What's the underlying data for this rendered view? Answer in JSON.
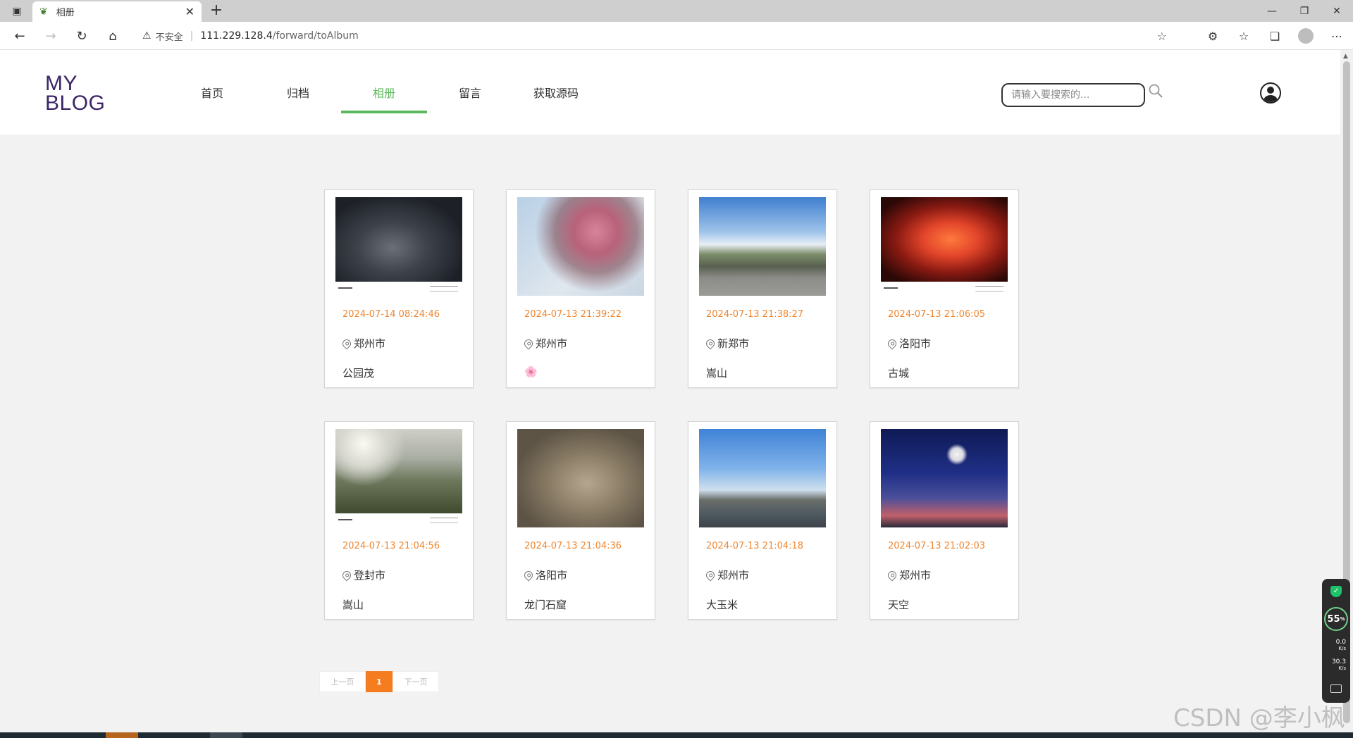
{
  "browser": {
    "tab_title": "相册",
    "address": {
      "security_label": "不安全",
      "host": "111.229.128.4",
      "path": "/forward/toAlbum"
    }
  },
  "site": {
    "logo_line1": "MY",
    "logo_line2": "BLOG",
    "nav": [
      {
        "label": "首页",
        "active": false
      },
      {
        "label": "归档",
        "active": false
      },
      {
        "label": "相册",
        "active": true
      },
      {
        "label": "留言",
        "active": false
      },
      {
        "label": "获取源码",
        "active": false
      }
    ],
    "search_placeholder": "请输入要搜索的...",
    "accent_color": "#5cb85c",
    "date_color": "#f0862f"
  },
  "album": [
    {
      "date": "2024-07-14 08:24:46",
      "location": "郑州市",
      "caption": "公园茂"
    },
    {
      "date": "2024-07-13 21:39:22",
      "location": "郑州市",
      "caption": "🌸"
    },
    {
      "date": "2024-07-13 21:38:27",
      "location": "新郑市",
      "caption": "嵩山"
    },
    {
      "date": "2024-07-13 21:06:05",
      "location": "洛阳市",
      "caption": "古城"
    },
    {
      "date": "2024-07-13 21:04:56",
      "location": "登封市",
      "caption": "嵩山"
    },
    {
      "date": "2024-07-13 21:04:36",
      "location": "洛阳市",
      "caption": "龙门石窟"
    },
    {
      "date": "2024-07-13 21:04:18",
      "location": "郑州市",
      "caption": "大玉米"
    },
    {
      "date": "2024-07-13 21:02:03",
      "location": "郑州市",
      "caption": "天空"
    }
  ],
  "pagination": {
    "prev": "上一页",
    "current": "1",
    "next": "下一页"
  },
  "widget": {
    "percent": "55",
    "percent_unit": "%",
    "up": "0.0",
    "down": "30.3",
    "unit": "K/s"
  },
  "watermark": "CSDN @李小枫"
}
